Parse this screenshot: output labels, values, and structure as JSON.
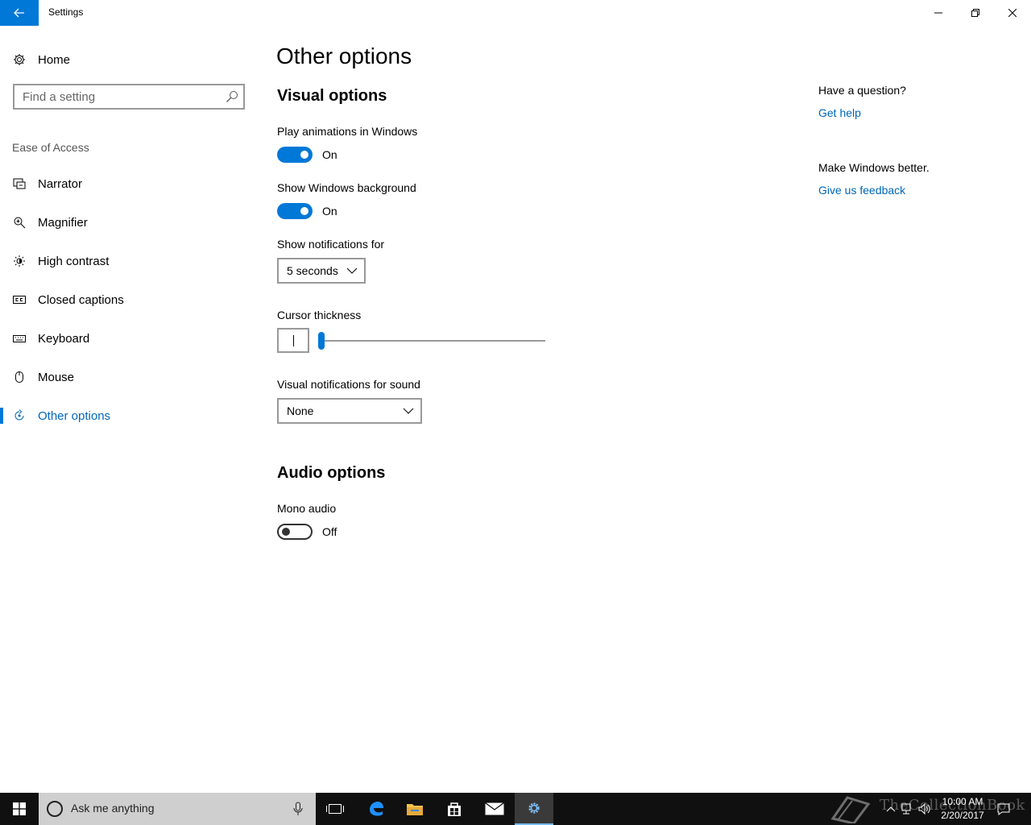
{
  "window": {
    "title": "Settings"
  },
  "sidebar": {
    "home_label": "Home",
    "search_placeholder": "Find a setting",
    "section_label": "Ease of Access",
    "items": [
      {
        "label": "Narrator",
        "icon": "narrator-icon"
      },
      {
        "label": "Magnifier",
        "icon": "magnifier-icon"
      },
      {
        "label": "High contrast",
        "icon": "high-contrast-icon"
      },
      {
        "label": "Closed captions",
        "icon": "closed-captions-icon"
      },
      {
        "label": "Keyboard",
        "icon": "keyboard-icon"
      },
      {
        "label": "Mouse",
        "icon": "mouse-icon"
      },
      {
        "label": "Other options",
        "icon": "other-options-icon",
        "active": true
      }
    ]
  },
  "main": {
    "title": "Other options",
    "visual_heading": "Visual options",
    "animations": {
      "label": "Play animations in Windows",
      "state": "On",
      "on": true
    },
    "background": {
      "label": "Show Windows background",
      "state": "On",
      "on": true
    },
    "notifications": {
      "label": "Show notifications for",
      "selected": "5 seconds"
    },
    "cursor": {
      "label": "Cursor thickness",
      "value_fraction": 0.0
    },
    "sound_notifications": {
      "label": "Visual notifications for sound",
      "selected": "None"
    },
    "audio_heading": "Audio options",
    "mono": {
      "label": "Mono audio",
      "state": "Off",
      "on": false
    }
  },
  "aside": {
    "question": "Have a question?",
    "get_help": "Get help",
    "better": "Make Windows better.",
    "feedback": "Give us feedback"
  },
  "taskbar": {
    "search_text": "Ask me anything",
    "time": "10:00 AM",
    "date": "2/20/2017",
    "watermark": "TheCollectionBook"
  },
  "colors": {
    "accent": "#0078d7",
    "link": "#0067b8",
    "taskbar": "#101010"
  }
}
